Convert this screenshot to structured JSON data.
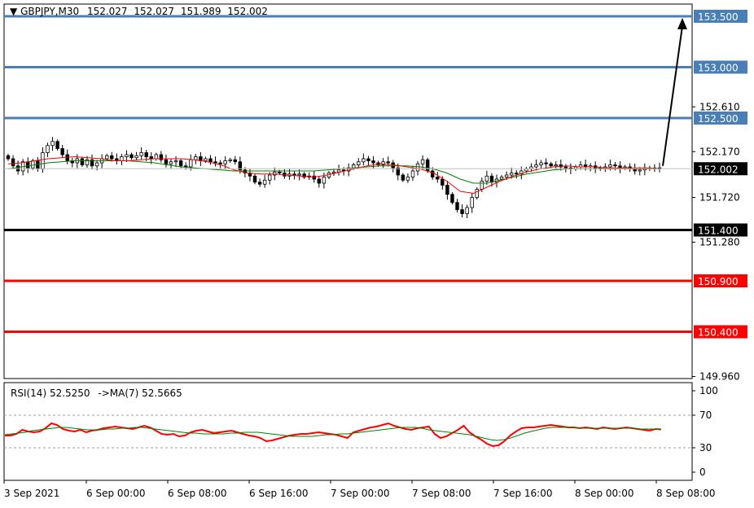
{
  "header": {
    "symbol": "GBPJPY,M30",
    "open": "152.027",
    "high": "152.027",
    "low": "151.989",
    "close": "152.002"
  },
  "rsi_header": {
    "label": "RSI(14) 52.5250",
    "ma_label": "->MA(7) 52.5665"
  },
  "colors": {
    "background": "#ffffff",
    "resistance": "#4a7fb5",
    "support": "#ff0000",
    "pivot": "#000000",
    "current_price": "#000000",
    "ma_fast": "#ff0000",
    "ma_slow": "#008000",
    "rsi": "#ff0000",
    "rsi_ma": "#008000",
    "candle_up": "#ffffff",
    "candle_down": "#000000"
  },
  "chart_data": [
    {
      "type": "candlestick",
      "title": "GBPJPY,M30",
      "price_ticks": [
        "152.610",
        "152.170",
        "151.720",
        "151.280",
        "149.960"
      ],
      "ylim": [
        149.94,
        153.62
      ],
      "x_ticks": [
        "3 Sep 2021",
        "6 Sep 00:00",
        "6 Sep 08:00",
        "6 Sep 16:00",
        "7 Sep 00:00",
        "7 Sep 08:00",
        "7 Sep 16:00",
        "8 Sep 00:00",
        "8 Sep 08:00"
      ],
      "levels": [
        {
          "value": 153.5,
          "label": "153.500",
          "kind": "resistance"
        },
        {
          "value": 153.0,
          "label": "153.000",
          "kind": "resistance"
        },
        {
          "value": 152.5,
          "label": "152.500",
          "kind": "resistance"
        },
        {
          "value": 151.4,
          "label": "151.400",
          "kind": "pivot"
        },
        {
          "value": 150.9,
          "label": "150.900",
          "kind": "support"
        },
        {
          "value": 150.4,
          "label": "150.400",
          "kind": "support"
        }
      ],
      "current_price": {
        "value": 152.002,
        "label": "152.002"
      },
      "projection_arrow": {
        "from_value": 152.03,
        "to_value": 153.5
      },
      "close_series": [
        152.1,
        152.03,
        151.98,
        152.07,
        152.01,
        152.08,
        152.0,
        152.16,
        152.23,
        152.27,
        152.2,
        152.14,
        152.08,
        152.06,
        152.1,
        152.04,
        152.09,
        152.03,
        152.06,
        152.1,
        152.13,
        152.1,
        152.08,
        152.12,
        152.14,
        152.11,
        152.13,
        152.16,
        152.12,
        152.1,
        152.14,
        152.09,
        152.05,
        152.07,
        152.08,
        152.03,
        152.02,
        152.09,
        152.12,
        152.08,
        152.1,
        152.07,
        152.06,
        152.05,
        152.08,
        152.09,
        152.07,
        151.99,
        151.96,
        151.93,
        151.87,
        151.85,
        151.89,
        151.94,
        151.97,
        151.96,
        151.93,
        151.95,
        151.94,
        151.95,
        151.92,
        151.93,
        151.9,
        151.86,
        151.92,
        151.96,
        151.97,
        151.99,
        151.98,
        152.01,
        152.04,
        152.07,
        152.1,
        152.08,
        152.06,
        152.04,
        152.07,
        152.06,
        152.01,
        151.94,
        151.89,
        151.92,
        151.98,
        152.05,
        152.09,
        151.98,
        151.92,
        151.9,
        151.84,
        151.75,
        151.67,
        151.6,
        151.56,
        151.62,
        151.72,
        151.8,
        151.88,
        151.93,
        151.87,
        151.9,
        151.92,
        151.94,
        151.96,
        151.95,
        151.98,
        152.0,
        152.02,
        152.04,
        152.06,
        152.05,
        152.03,
        152.04,
        152.02,
        152.01,
        152.0,
        152.02,
        152.04,
        152.02,
        152.03,
        152.01,
        152.0,
        152.02,
        152.04,
        152.03,
        152.01,
        152.02,
        152.0,
        151.98,
        151.99,
        152.01,
        152.0,
        152.01,
        152.002
      ],
      "ma_fast": [
        152.05,
        152.06,
        152.08,
        152.1,
        152.11,
        152.12,
        152.11,
        152.1,
        152.08,
        152.08,
        152.09,
        152.1,
        152.1,
        152.1,
        152.09,
        152.07,
        152.04,
        151.99,
        151.96,
        151.95,
        151.95,
        151.94,
        151.93,
        151.92,
        151.94,
        151.97,
        152.0,
        152.03,
        152.05,
        152.04,
        152.02,
        152.0,
        151.96,
        151.88,
        151.78,
        151.76,
        151.82,
        151.88,
        151.93,
        151.97,
        152.0,
        152.02,
        152.03,
        152.02,
        152.02,
        152.01,
        152.01,
        152.01,
        152.01,
        152.002
      ],
      "ma_slow": [
        152.0,
        152.02,
        152.04,
        152.06,
        152.07,
        152.08,
        152.08,
        152.08,
        152.08,
        152.08,
        152.07,
        152.06,
        152.04,
        152.02,
        152.01,
        152.0,
        151.99,
        151.98,
        151.98,
        151.98,
        151.98,
        151.98,
        151.98,
        151.98,
        151.99,
        152.0,
        152.01,
        152.02,
        152.03,
        152.03,
        152.03,
        152.02,
        152.0,
        151.96,
        151.9,
        151.86,
        151.86,
        151.89,
        151.92,
        151.95,
        151.97,
        151.99,
        152.0,
        152.0,
        152.0,
        152.0,
        152.0,
        152.0,
        152.0,
        152.0
      ]
    },
    {
      "type": "line",
      "title": "RSI(14) 52.5250",
      "y_ticks": [
        100,
        70,
        30,
        0
      ],
      "ylim": [
        0,
        100
      ],
      "levels": [
        70,
        30
      ],
      "series": [
        {
          "name": "RSI(14)",
          "values": [
            45,
            45,
            47,
            52,
            50,
            49,
            50,
            54,
            60,
            58,
            53,
            51,
            50,
            52,
            49,
            51,
            52,
            54,
            55,
            56,
            55,
            54,
            53,
            55,
            57,
            55,
            51,
            47,
            46,
            47,
            44,
            45,
            49,
            51,
            52,
            50,
            48,
            49,
            50,
            51,
            49,
            47,
            45,
            44,
            42,
            38,
            39,
            41,
            43,
            45,
            46,
            47,
            47,
            48,
            49,
            48,
            47,
            46,
            44,
            42,
            49,
            51,
            53,
            55,
            56,
            58,
            60,
            57,
            55,
            53,
            52,
            54,
            55,
            56,
            47,
            42,
            44,
            48,
            52,
            57,
            49,
            44,
            40,
            35,
            32,
            33,
            38,
            45,
            50,
            54,
            55,
            55,
            56,
            57,
            58,
            57,
            56,
            55,
            55,
            54,
            55,
            54,
            53,
            55,
            54,
            53,
            54,
            55,
            54,
            53,
            52,
            51,
            53,
            52.525
          ]
        },
        {
          "name": "MA(7)",
          "values": [
            46,
            47,
            48,
            49,
            51,
            52,
            53,
            54,
            55,
            55,
            54,
            53,
            52,
            52,
            52,
            53,
            53,
            54,
            54,
            55,
            55,
            54,
            53,
            52,
            51,
            50,
            49,
            48,
            48,
            47,
            47,
            47,
            47,
            48,
            48,
            49,
            49,
            49,
            48,
            47,
            46,
            45,
            44,
            44,
            44,
            44,
            45,
            46,
            46,
            47,
            47,
            48,
            49,
            50,
            51,
            52,
            53,
            54,
            55,
            55,
            55,
            54,
            52,
            51,
            50,
            49,
            48,
            47,
            46,
            44,
            42,
            40,
            39,
            40,
            42,
            45,
            48,
            50,
            52,
            54,
            55,
            55,
            55,
            55,
            54,
            54,
            54,
            54,
            54,
            54,
            54,
            54,
            54,
            53,
            53,
            53,
            52.5665
          ]
        }
      ]
    }
  ]
}
